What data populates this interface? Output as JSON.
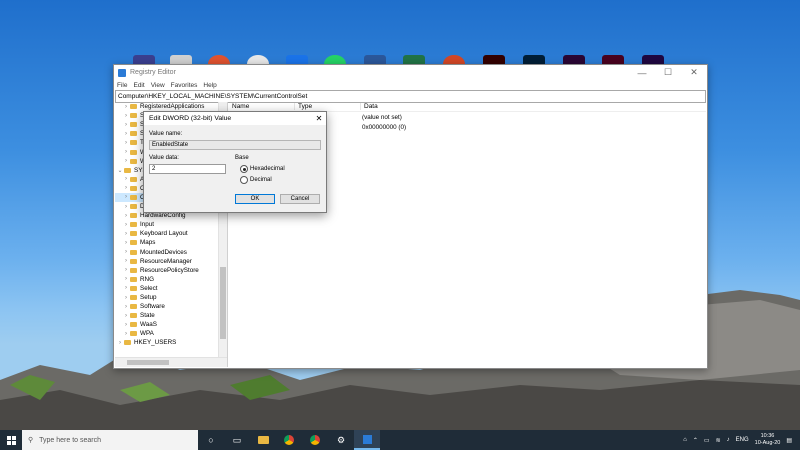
{
  "window": {
    "title": "Registry Editor",
    "menu": [
      "File",
      "Edit",
      "View",
      "Favorites",
      "Help"
    ],
    "address": "Computer\\HKEY_LOCAL_MACHINE\\SYSTEM\\CurrentControlSet"
  },
  "tree": {
    "items": [
      {
        "label": "RegisteredApplications"
      },
      {
        "label": "SO"
      },
      {
        "label": "SY"
      },
      {
        "label": "Sy"
      },
      {
        "label": "TH"
      },
      {
        "label": "W"
      },
      {
        "label": "W"
      },
      {
        "label": "SYST"
      },
      {
        "label": "Ac"
      },
      {
        "label": "Cr"
      },
      {
        "label": "Cu"
      },
      {
        "label": "DriverDatabase"
      },
      {
        "label": "HardwareConfig"
      },
      {
        "label": "Input"
      },
      {
        "label": "Keyboard Layout"
      },
      {
        "label": "Maps"
      },
      {
        "label": "MountedDevices"
      },
      {
        "label": "ResourceManager"
      },
      {
        "label": "ResourcePolicyStore"
      },
      {
        "label": "RNG"
      },
      {
        "label": "Select"
      },
      {
        "label": "Setup"
      },
      {
        "label": "Software"
      },
      {
        "label": "State"
      },
      {
        "label": "WaaS"
      },
      {
        "label": "WPA"
      },
      {
        "label": "HKEY_USERS"
      }
    ]
  },
  "list": {
    "headers": {
      "name": "Name",
      "type": "Type",
      "data": "Data"
    },
    "rows": [
      {
        "data": "(value not set)"
      },
      {
        "data": "0x00000000 (0)"
      }
    ]
  },
  "dialog": {
    "title": "Edit DWORD (32-bit) Value",
    "value_name_label": "Value name:",
    "value_name": "EnabledState",
    "value_data_label": "Value data:",
    "value_data": "2",
    "base_label": "Base",
    "hex_label": "Hexadecimal",
    "dec_label": "Decimal",
    "ok": "OK",
    "cancel": "Cancel"
  },
  "taskbar": {
    "search_placeholder": "Type here to search",
    "lang": "ENG",
    "time": "10:36",
    "date": "10-Aug-20"
  },
  "colors": {
    "accent": "#0078d7",
    "taskbar": "#1f2c38",
    "folder": "#e9b843"
  }
}
